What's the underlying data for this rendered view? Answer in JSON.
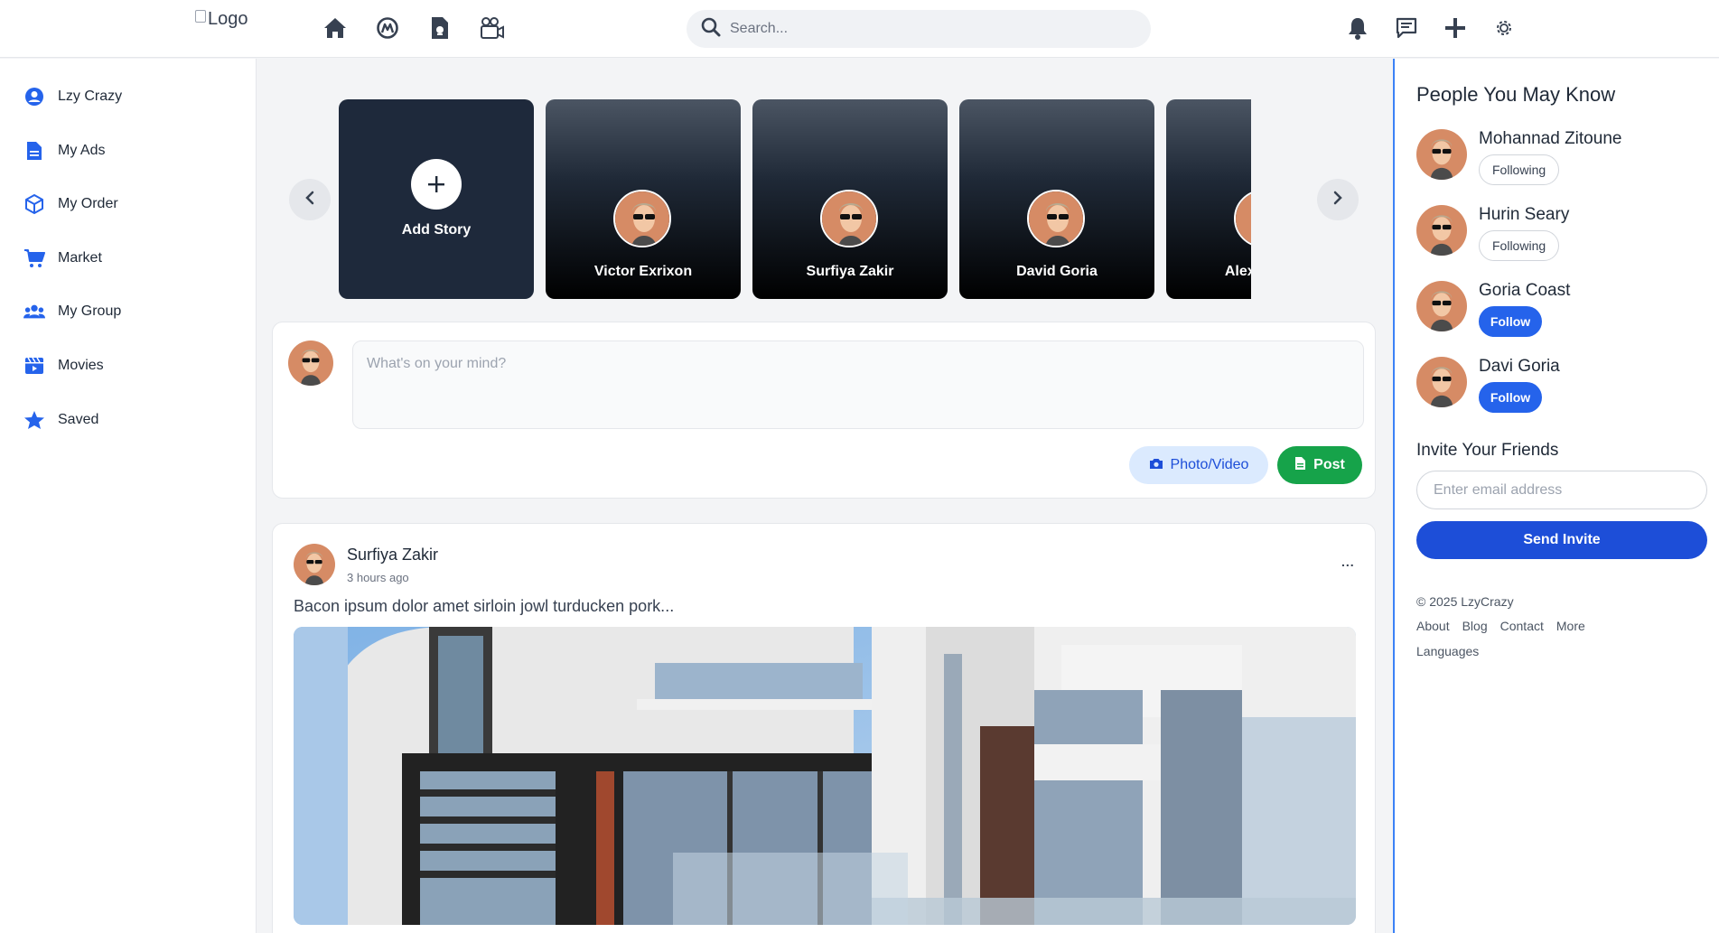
{
  "header": {
    "logo_alt": "Logo",
    "search_placeholder": "Search..."
  },
  "sidebar": {
    "items": [
      {
        "label": "Lzy Crazy",
        "icon": "user-circle-icon"
      },
      {
        "label": "My Ads",
        "icon": "document-icon"
      },
      {
        "label": "My Order",
        "icon": "box-icon"
      },
      {
        "label": "Market",
        "icon": "cart-icon"
      },
      {
        "label": "My Group",
        "icon": "group-icon"
      },
      {
        "label": "Movies",
        "icon": "film-icon"
      },
      {
        "label": "Saved",
        "icon": "star-icon"
      }
    ]
  },
  "stories": {
    "add_label": "Add Story",
    "items": [
      {
        "name": "Victor Exrixon"
      },
      {
        "name": "Surfiya Zakir"
      },
      {
        "name": "David Goria"
      },
      {
        "name": "Alex Moore"
      }
    ]
  },
  "composer": {
    "placeholder": "What's on your mind?",
    "photo_label": "Photo/Video",
    "post_label": "Post"
  },
  "post": {
    "author": "Surfiya Zakir",
    "time": "3 hours ago",
    "text": "Bacon ipsum dolor amet sirloin jowl turducken pork...",
    "menu": "..."
  },
  "people": {
    "title": "People You May Know",
    "items": [
      {
        "name": "Mohannad Zitoune",
        "action": "Following"
      },
      {
        "name": "Hurin Seary",
        "action": "Following"
      },
      {
        "name": "Goria Coast",
        "action": "Follow"
      },
      {
        "name": "Davi Goria",
        "action": "Follow"
      }
    ]
  },
  "invite": {
    "title": "Invite Your Friends",
    "placeholder": "Enter email address",
    "button": "Send Invite"
  },
  "footer": {
    "copyright": "© 2025 LzyCrazy",
    "links": [
      "About",
      "Blog",
      "Contact",
      "More"
    ],
    "languages": "Languages"
  },
  "colors": {
    "accent": "#2563eb",
    "post_green": "#16a34a",
    "right_border": "#3b82f6"
  }
}
